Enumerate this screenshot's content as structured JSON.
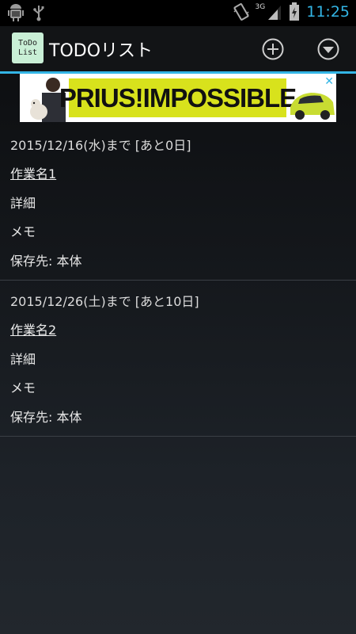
{
  "status_bar": {
    "time": "11:25",
    "network": "3G",
    "icons": [
      "android-debug-icon",
      "usb-icon",
      "vibrate-icon",
      "signal-icon",
      "battery-charging-icon"
    ]
  },
  "action_bar": {
    "app_icon_lines": [
      "ToDo",
      "List"
    ],
    "title": "TODOリスト",
    "add_icon": "add-circle-icon",
    "menu_icon": "dropdown-circle-icon",
    "accent_color": "#33b5e5"
  },
  "ad": {
    "text": "PRIUS!IMPOSSIBLE",
    "close_icon": "close-x-icon",
    "background_color": "#d8e21c"
  },
  "todos": [
    {
      "due": "2015/12/16(水)まで [あと0日]",
      "name": "作業名1",
      "detail": "詳細",
      "memo": "メモ",
      "storage": "保存先: 本体"
    },
    {
      "due": "2015/12/26(土)まで [あと10日]",
      "name": "作業名2",
      "detail": "詳細",
      "memo": "メモ",
      "storage": "保存先: 本体"
    }
  ]
}
